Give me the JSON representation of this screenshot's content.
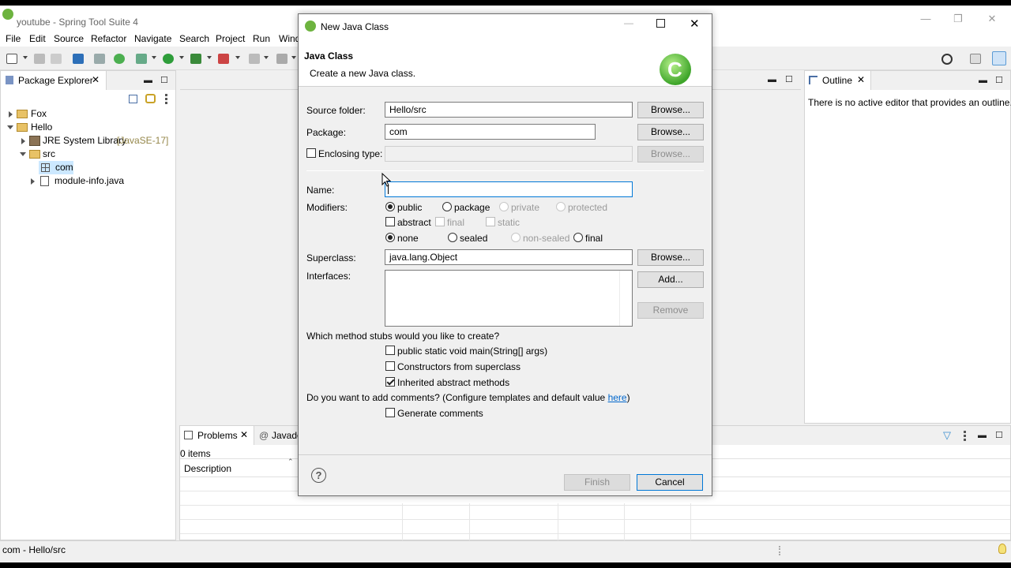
{
  "app": {
    "title": "youtube - Spring Tool Suite 4"
  },
  "window_buttons": {
    "minimize": "—",
    "restore": "❐",
    "close": "✕"
  },
  "menu": [
    "File",
    "Edit",
    "Source",
    "Refactor",
    "Navigate",
    "Search",
    "Project",
    "Run",
    "Wind"
  ],
  "package_explorer": {
    "tab": "Package Explorer",
    "tree": [
      {
        "label": "Fox",
        "extra": ""
      },
      {
        "label": "Hello",
        "extra": ""
      },
      {
        "label": "JRE System Library",
        "extra": "[JavaSE-17]"
      },
      {
        "label": "src",
        "extra": ""
      },
      {
        "label": "com",
        "extra": ""
      },
      {
        "label": "module-info.java",
        "extra": ""
      }
    ]
  },
  "outline": {
    "tab": "Outline",
    "message": "There is no active editor that provides an outline."
  },
  "problems": {
    "tab": "Problems",
    "tab2": "Javado",
    "count": "0 items",
    "column": "Description"
  },
  "status_bar": {
    "text": "com - Hello/src"
  },
  "dialog": {
    "window_title": "New Java Class",
    "heading": "Java Class",
    "subheading": "Create a new Java class.",
    "source_folder": {
      "label": "Source folder:",
      "value": "Hello/src",
      "button": "Browse..."
    },
    "package": {
      "label": "Package:",
      "value": "com",
      "button": "Browse..."
    },
    "enclosing": {
      "label": "Enclosing type:",
      "value": "",
      "button": "Browse..."
    },
    "name": {
      "label": "Name:",
      "value": ""
    },
    "modifiers": {
      "label": "Modifiers:",
      "access": [
        "public",
        "package",
        "private",
        "protected"
      ],
      "flags": [
        "abstract",
        "final",
        "static"
      ],
      "inherit": [
        "none",
        "sealed",
        "non-sealed",
        "final"
      ]
    },
    "superclass": {
      "label": "Superclass:",
      "value": "java.lang.Object",
      "button": "Browse..."
    },
    "interfaces": {
      "label": "Interfaces:",
      "add": "Add...",
      "remove": "Remove"
    },
    "stubs": {
      "question": "Which method stubs would you like to create?",
      "items": [
        "public static void main(String[] args)",
        "Constructors from superclass",
        "Inherited abstract methods"
      ]
    },
    "comments": {
      "question": "Do you want to add comments? (Configure templates and default value ",
      "link": "here",
      "close_paren": ")",
      "generate": "Generate comments"
    },
    "help": "?",
    "finish": "Finish",
    "cancel": "Cancel"
  }
}
